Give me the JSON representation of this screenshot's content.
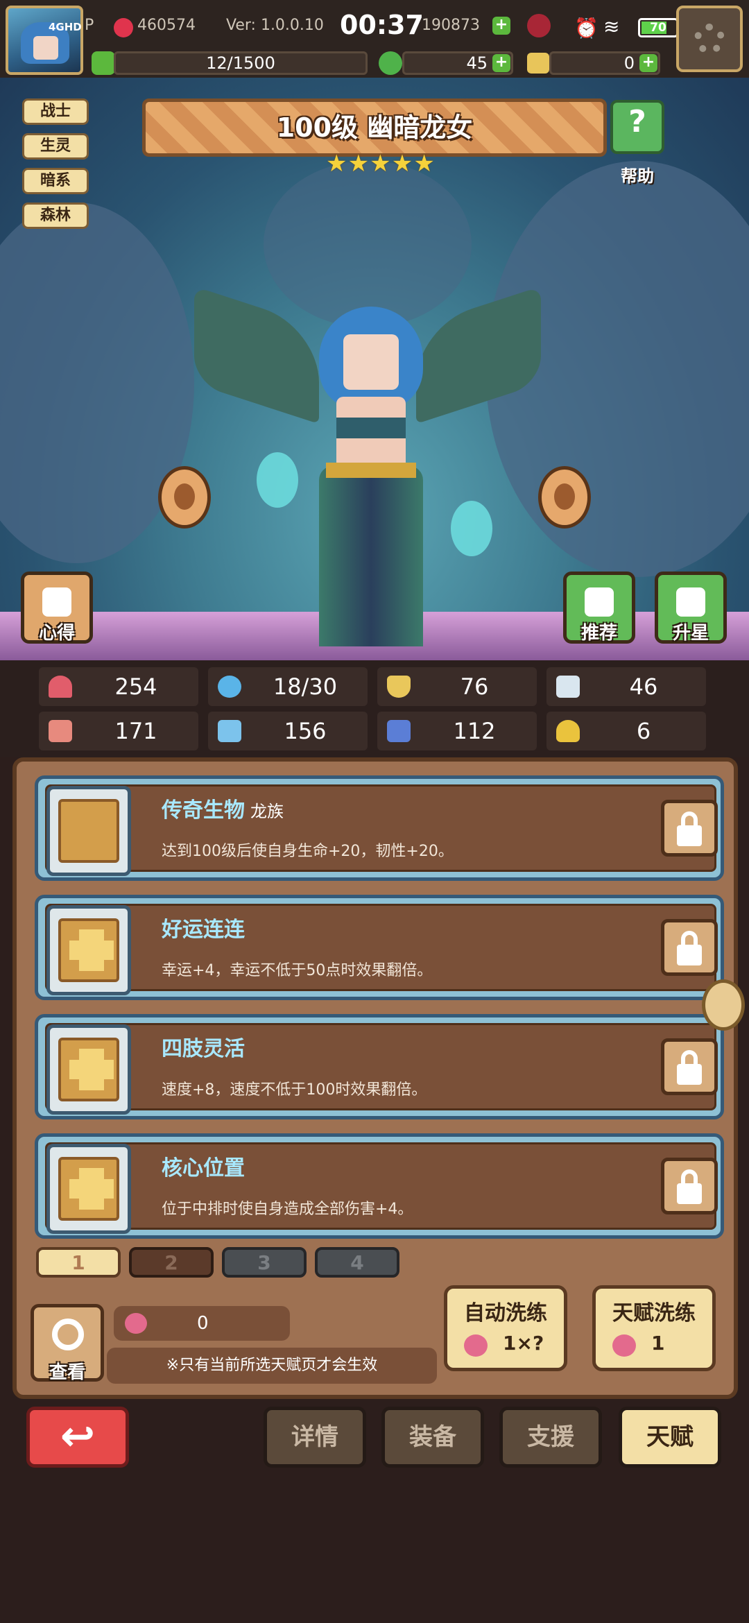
{
  "status": {
    "network": "4GHD",
    "id_prefix": "P",
    "id": "460574",
    "version": "Ver: 1.0.0.10",
    "time": "00:37",
    "gold": "190873",
    "battery": "70"
  },
  "resources": {
    "stamina": "12/1500",
    "clover": "45",
    "coins": "0"
  },
  "hero": {
    "title": "100级 幽暗龙女",
    "stars": [
      "★",
      "★",
      "★",
      "★",
      "★"
    ],
    "tags": [
      "战士",
      "生灵",
      "暗系",
      "森林"
    ],
    "help_label": "帮助",
    "notes_label": "心得",
    "recommend_label": "推荐",
    "starup_label": "升星"
  },
  "stats": [
    {
      "icon": "heart-icon",
      "value": "254"
    },
    {
      "icon": "drop-icon",
      "value": "18/30"
    },
    {
      "icon": "shield-icon",
      "value": "76"
    },
    {
      "icon": "wing-icon",
      "value": "46"
    },
    {
      "icon": "fist-icon",
      "value": "171"
    },
    {
      "icon": "book-icon",
      "value": "156"
    },
    {
      "icon": "boot-icon",
      "value": "112"
    },
    {
      "icon": "horseshoe-icon",
      "value": "6"
    }
  ],
  "talents": [
    {
      "name": "传奇生物",
      "sub": "龙族",
      "desc": "达到100级后使自身生命+20，韧性+20。"
    },
    {
      "name": "好运连连",
      "sub": "",
      "desc": "幸运+4，幸运不低于50点时效果翻倍。"
    },
    {
      "name": "四肢灵活",
      "sub": "",
      "desc": "速度+8，速度不低于100时效果翻倍。"
    },
    {
      "name": "核心位置",
      "sub": "",
      "desc": "位于中排时使自身造成全部伤害+4。"
    }
  ],
  "pages": [
    "1",
    "2",
    "3",
    "4"
  ],
  "controls": {
    "view_label": "查看",
    "fruit_count": "0",
    "note": "※只有当前所选天赋页才会生效",
    "auto_wash_label": "自动洗练",
    "auto_wash_cost": "1×?",
    "wash_label": "天赋洗练",
    "wash_cost": "1"
  },
  "nav": {
    "back_glyph": "↩",
    "tabs": [
      "详情",
      "装备",
      "支援",
      "天赋"
    ],
    "active": "天赋"
  }
}
